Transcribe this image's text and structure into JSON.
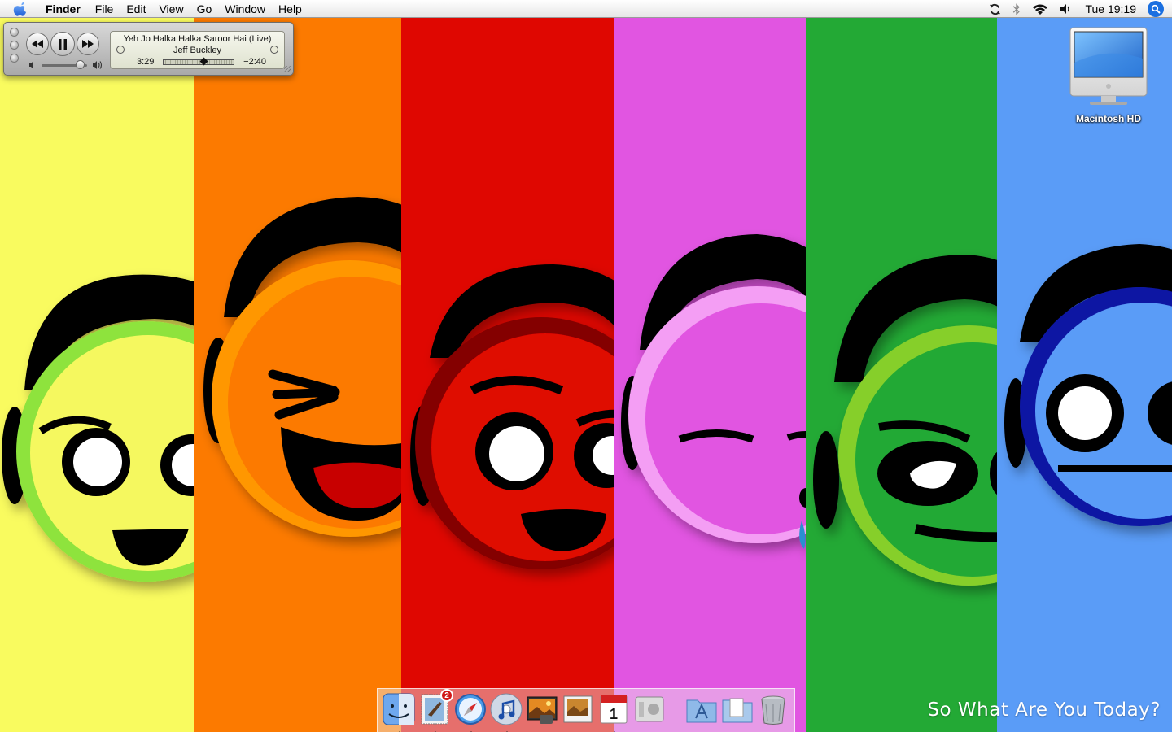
{
  "menubar": {
    "app_name": "Finder",
    "items": [
      "File",
      "Edit",
      "View",
      "Go",
      "Window",
      "Help"
    ],
    "clock": "Tue 19:19",
    "status_icons": [
      "sync-icon",
      "bluetooth-icon",
      "wifi-icon",
      "volume-icon",
      "spotlight-icon"
    ]
  },
  "itunes_mini": {
    "song": "Yeh Jo Halka Halka Saroor Hai (Live)",
    "artist": "Jeff Buckley",
    "elapsed": "3:29",
    "remaining": "−2:40",
    "progress": 0.57,
    "volume": 0.85,
    "state": "playing"
  },
  "desktop": {
    "icons": [
      {
        "label": "Macintosh HD",
        "icon": "imac-icon"
      }
    ],
    "wallpaper_tagline": "So What Are You Today?"
  },
  "wallpaper": {
    "stripe_colors": [
      "#f9fb5f",
      "#fc7a00",
      "#df0701",
      "#e155e1",
      "#23a935",
      "#5a9cf7"
    ],
    "ring_colors": [
      "#8ee33c",
      "#ff9700",
      "#840000",
      "#f49ef4",
      "#86cf2c",
      "#1019a3"
    ]
  },
  "dock": {
    "items": [
      {
        "name": "finder",
        "running": true
      },
      {
        "name": "mail",
        "running": true,
        "badge": "2"
      },
      {
        "name": "safari",
        "running": true
      },
      {
        "name": "itunes",
        "running": true
      },
      {
        "name": "iphoto",
        "running": false
      },
      {
        "name": "preview",
        "running": false
      },
      {
        "name": "ical",
        "running": true
      },
      {
        "name": "system-preferences",
        "running": false
      },
      {
        "name": "applications-folder",
        "running": false
      },
      {
        "name": "documents-stack",
        "running": false
      },
      {
        "name": "trash",
        "running": false
      }
    ]
  }
}
